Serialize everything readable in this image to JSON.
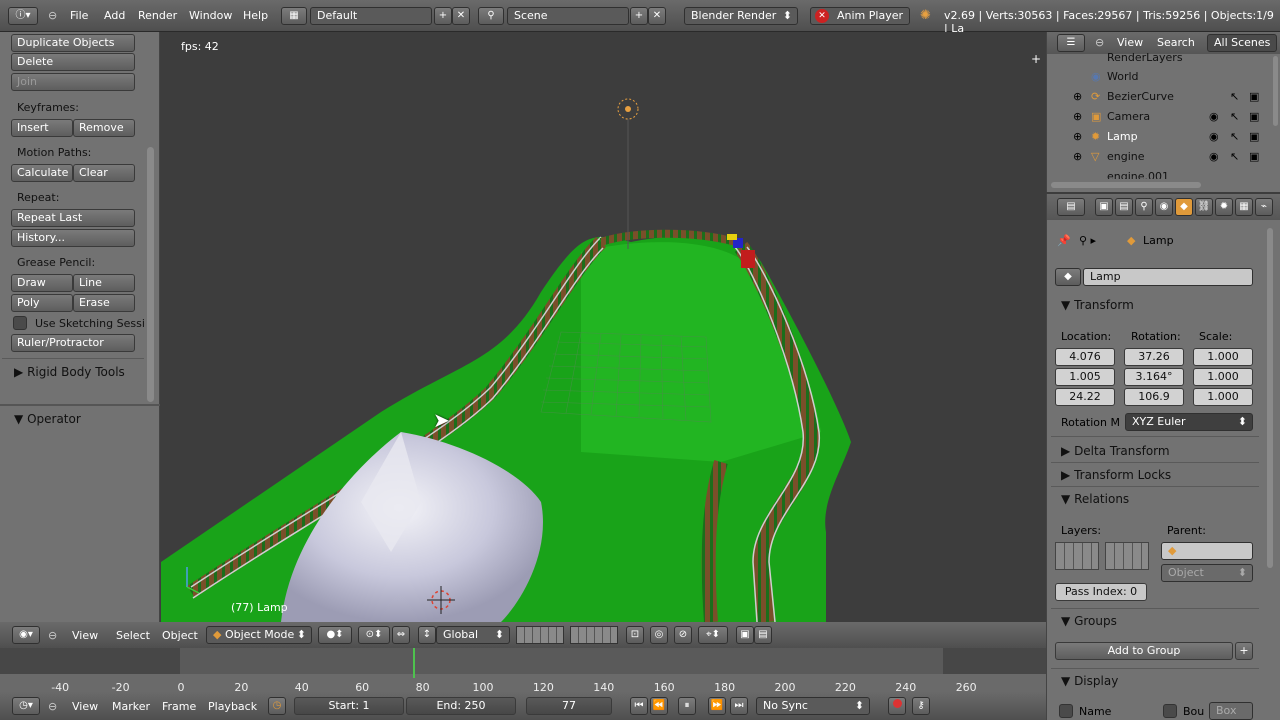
{
  "top": {
    "menus": [
      "File",
      "Add",
      "Render",
      "Window",
      "Help"
    ],
    "screen_layout": "Default",
    "scene": "Scene",
    "engine": "Blender Render",
    "anim_player": "Anim Player",
    "stats": "v2.69 | Verts:30563 | Faces:29567 | Tris:59256 | Objects:1/9 | La"
  },
  "toolshelf": {
    "duplicate": "Duplicate Objects",
    "delete": "Delete",
    "join": "Join",
    "keyframes_label": "Keyframes:",
    "insert": "Insert",
    "remove": "Remove",
    "motion_paths_label": "Motion Paths:",
    "calculate": "Calculate",
    "clear": "Clear",
    "repeat_label": "Repeat:",
    "repeat_last": "Repeat Last",
    "history": "History...",
    "grease_label": "Grease Pencil:",
    "draw": "Draw",
    "line": "Line",
    "poly": "Poly",
    "erase": "Erase",
    "use_sketching": "Use Sketching Sessi",
    "ruler": "Ruler/Protractor",
    "rigid_body": "Rigid Body Tools",
    "operator": "Operator"
  },
  "viewport": {
    "fps": "fps: 42",
    "object_label": "(77) Lamp"
  },
  "outliner": {
    "view": "View",
    "search": "Search",
    "filter": "All Scenes",
    "items": [
      "RenderLayers",
      "World",
      "BezierCurve",
      "Camera",
      "Lamp",
      "engine",
      "engine.001"
    ]
  },
  "properties": {
    "breadcrumb": "Lamp",
    "object_name": "Lamp",
    "transform": "Transform",
    "location_label": "Location:",
    "rotation_label": "Rotation:",
    "scale_label": "Scale:",
    "location": [
      "4.076",
      "1.005",
      "24.22"
    ],
    "rotation": [
      "37.26",
      "3.164°",
      "106.9"
    ],
    "scale": [
      "1.000",
      "1.000",
      "1.000"
    ],
    "rotation_mode_label": "Rotation M",
    "rotation_mode": "XYZ Euler",
    "delta_transform": "Delta Transform",
    "transform_locks": "Transform Locks",
    "relations": "Relations",
    "layers_label": "Layers:",
    "parent_label": "Parent:",
    "parent_type": "Object",
    "pass_index": "Pass Index: 0",
    "groups": "Groups",
    "add_to_group": "Add to Group",
    "display": "Display",
    "name": "Name",
    "bounds": "Bou",
    "box": "Box"
  },
  "view_header": {
    "view": "View",
    "select": "Select",
    "object": "Object",
    "mode": "Object Mode",
    "orientation": "Global"
  },
  "timeline": {
    "ticks": [
      "-40",
      "-20",
      "0",
      "20",
      "40",
      "60",
      "80",
      "100",
      "120",
      "140",
      "160",
      "180",
      "200",
      "220",
      "240",
      "260"
    ],
    "current_frame": 77
  },
  "timeline_header": {
    "view": "View",
    "marker": "Marker",
    "frame": "Frame",
    "playback": "Playback",
    "start": "Start: 1",
    "end": "End: 250",
    "current": "77",
    "sync": "No Sync"
  },
  "colors": {
    "terrain": "#1aa51a",
    "background": "#3d3d3d",
    "panel": "#727272"
  }
}
